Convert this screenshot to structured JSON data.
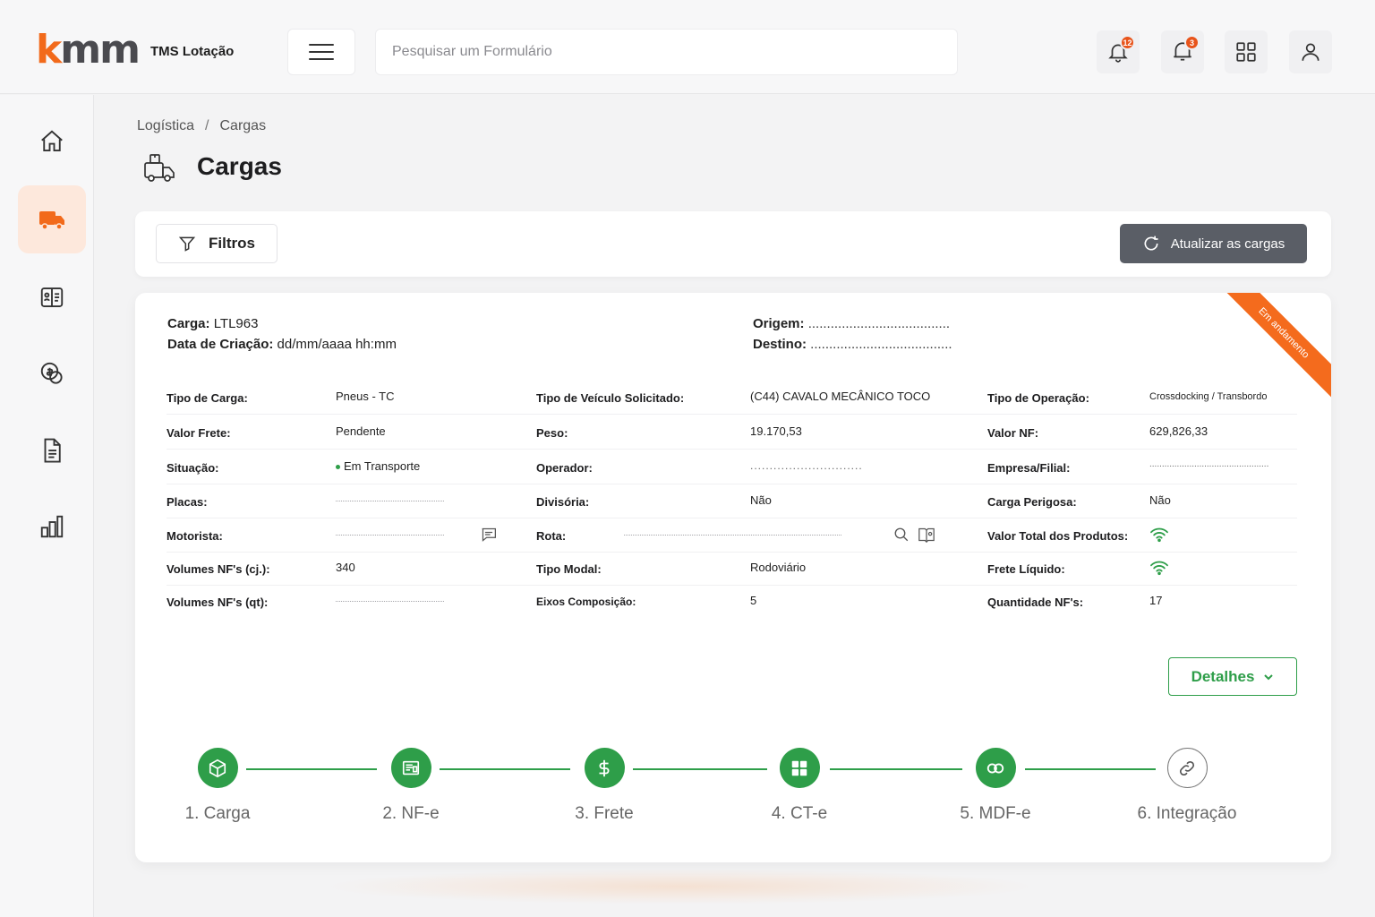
{
  "header": {
    "logo_k": "k",
    "logo_rest": "mm",
    "app_name": "TMS Lotação",
    "search_placeholder": "Pesquisar um Formulário",
    "notif_badge_1": "12",
    "notif_badge_2": "3"
  },
  "breadcrumb": {
    "root": "Logística",
    "sep": "/",
    "current": "Cargas"
  },
  "page_title": "Cargas",
  "toolbar": {
    "filters_label": "Filtros",
    "refresh_label": "Atualizar as cargas"
  },
  "card": {
    "ribbon": "Em andamento",
    "carga_label": "Carga:",
    "carga_value": "LTL963",
    "data_label": "Data de Criação:",
    "data_value": "dd/mm/aaaa hh:mm",
    "origem_label": "Origem:",
    "origem_value": "......................................",
    "destino_label": "Destino:",
    "destino_value": "......................................",
    "rows": [
      {
        "l1": "Tipo de Carga:",
        "v1": "Pneus - TC",
        "l2": "Tipo de Veículo Solicitado:",
        "v2": "(C44) CAVALO MECÂNICO TOCO",
        "l3": "Tipo de Operação:",
        "v3": "Crossdocking / Transbordo"
      },
      {
        "l1": "Valor Frete:",
        "v1": "Pendente",
        "l2": "Peso:",
        "v2": "19.170,53",
        "l3": "Valor NF:",
        "v3": "629,826,33"
      },
      {
        "l1": "Situação:",
        "v1": "Em Transporte",
        "l2": "Operador:",
        "v2": ".............................",
        "l3": "Empresa/Filial:",
        "v3": "................................................"
      },
      {
        "l1": "Placas:",
        "v1": "",
        "l2": "Divisória:",
        "v2": "Não",
        "l3": "Carga Perigosa:",
        "v3": "Não"
      },
      {
        "l1": "Motorista:",
        "v1": "",
        "l2": "Rota:",
        "v2": "",
        "l3": "Valor Total dos Produtos:",
        "v3": ""
      },
      {
        "l1": "Volumes NF's (cj.):",
        "v1": "340",
        "l2": "Tipo Modal:",
        "v2": "Rodoviário",
        "l3": "Frete Líquido:",
        "v3": ""
      },
      {
        "l1": "Volumes NF's (qt):",
        "v1": "",
        "l2": "Eixos Composição:",
        "v2": "5",
        "l3": "Quantidade NF's:",
        "v3": "17"
      }
    ],
    "details_label": "Detalhes"
  },
  "steps": [
    {
      "label": "1. Carga",
      "status": "done",
      "icon": "package-icon"
    },
    {
      "label": "2. NF-e",
      "status": "done",
      "icon": "invoice-icon"
    },
    {
      "label": "3. Frete",
      "status": "done",
      "icon": "dollar-icon"
    },
    {
      "label": "4. CT-e",
      "status": "done",
      "icon": "grid-icon"
    },
    {
      "label": "5. MDF-e",
      "status": "done",
      "icon": "link-icon"
    },
    {
      "label": "6. Integração",
      "status": "pending",
      "icon": "link-icon"
    }
  ],
  "colors": {
    "brand_orange": "#f26a1b",
    "success_green": "#2e9e49",
    "refresh_btn": "#5a5e66"
  }
}
